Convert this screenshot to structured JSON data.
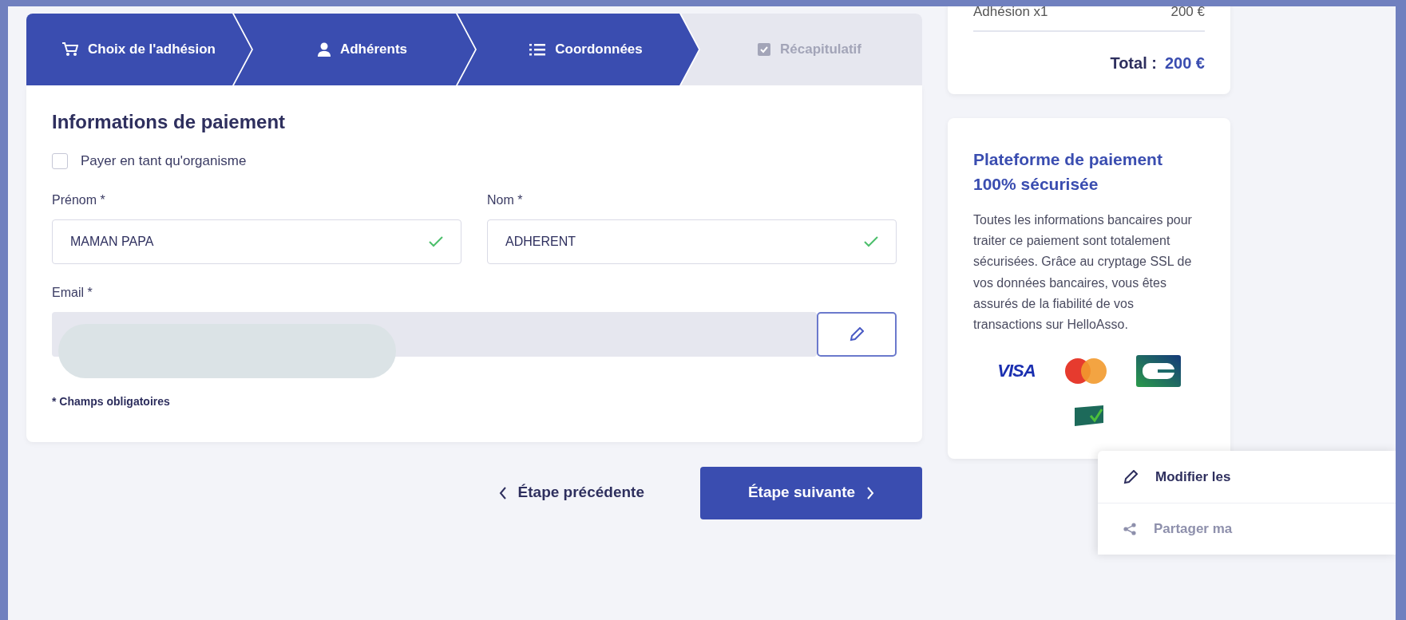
{
  "steps": [
    {
      "label": "Choix de l'adhésion",
      "kind": "cart",
      "done": true
    },
    {
      "label": "Adhérents",
      "kind": "person",
      "done": true
    },
    {
      "label": "Coordonnées",
      "kind": "list",
      "done": true
    },
    {
      "label": "Récapitulatif",
      "kind": "check",
      "done": false
    }
  ],
  "form": {
    "title": "Informations de paiement",
    "organization": {
      "label": "Payer en tant qu'organisme",
      "checked": false
    },
    "fields": [
      {
        "label": "Prénom *",
        "value": "MAMAN PAPA",
        "valid": true
      },
      {
        "label": "Nom *",
        "value": "ADHERENT",
        "valid": true
      }
    ],
    "email": {
      "label": "Email *",
      "disabled": true,
      "redacted": true
    },
    "note": "* Champs obligatoires"
  },
  "nav": {
    "previous": "Étape précédente",
    "next": "Étape suivante"
  },
  "summary": {
    "line": {
      "label": "Adhésion x1",
      "amount": "200 €"
    },
    "total_label": "Total :",
    "total": "200 €"
  },
  "security": {
    "title": "Plateforme de paiement 100% sécurisée",
    "text": "Toutes les informations bancaires pour traiter ce paiement sont totalement sécurisées. Grâce au cryptage SSL de vos données bancaires, vous êtes assurés de la fiabilité de vos transactions sur HelloAsso.",
    "logos": [
      {
        "kind": "visa",
        "label": "VISA"
      },
      {
        "kind": "mastercard"
      },
      {
        "kind": "cb"
      },
      {
        "kind": "pci"
      }
    ]
  },
  "menu": [
    {
      "kind": "edit",
      "label": "Modifier les",
      "muted": false
    },
    {
      "kind": "share",
      "label": "Partager ma",
      "muted": true
    }
  ]
}
